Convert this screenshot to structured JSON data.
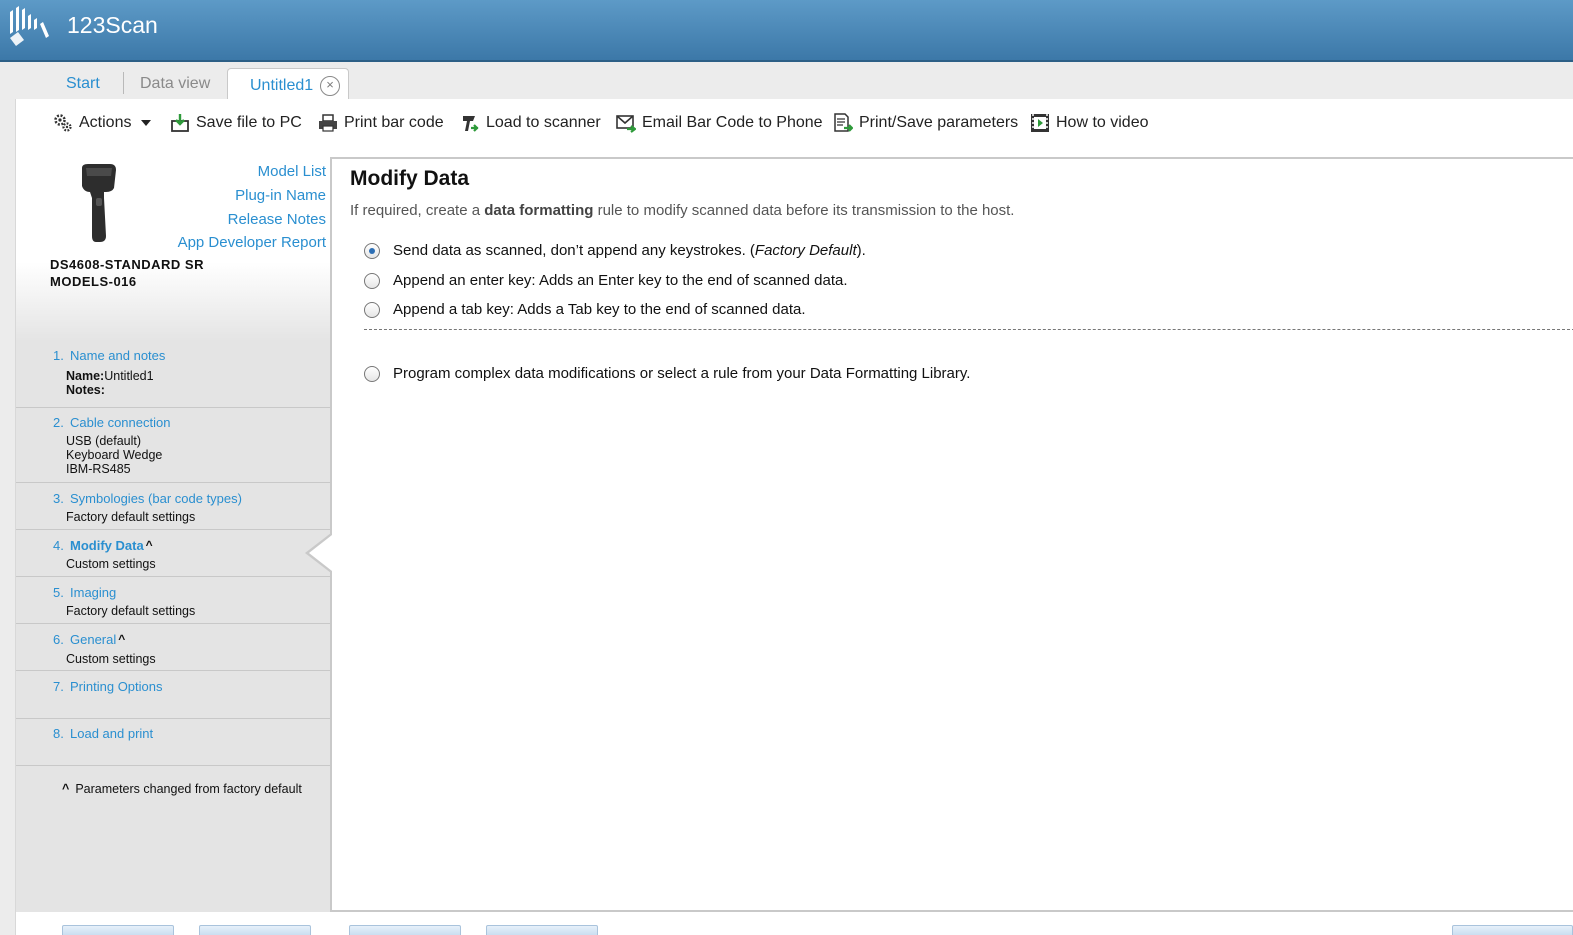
{
  "app": {
    "title": "123Scan"
  },
  "tabs": {
    "start": "Start",
    "data_view": "Data view",
    "active": "Untitled1",
    "close_glyph": "×"
  },
  "toolbar": {
    "actions": "Actions",
    "save": "Save file to PC",
    "print": "Print bar code",
    "load": "Load to scanner",
    "email": "Email Bar Code to Phone",
    "print_save_params": "Print/Save parameters",
    "video": "How to video"
  },
  "device": {
    "model_list": "Model List",
    "plugin_name": "Plug-in Name",
    "release_notes": "Release Notes",
    "dev_report": "App Developer Report",
    "name_line1": "DS4608-STANDARD SR",
    "name_line2": "MODELS-016"
  },
  "steps": [
    {
      "num": "1.",
      "title": "Name and notes",
      "lines": [
        "Untitled1",
        ""
      ],
      "name_label": "Name:",
      "notes_label": "Notes:"
    },
    {
      "num": "2.",
      "title": "Cable connection",
      "lines": [
        "USB (default)",
        "Keyboard Wedge",
        "IBM-RS485"
      ]
    },
    {
      "num": "3.",
      "title": "Symbologies (bar code types)",
      "lines": [
        "Factory default settings"
      ]
    },
    {
      "num": "4.",
      "title": "Modify Data",
      "mark": "^",
      "lines": [
        "Custom settings"
      ]
    },
    {
      "num": "5.",
      "title": "Imaging",
      "lines": [
        "Factory default settings"
      ]
    },
    {
      "num": "6.",
      "title": "General",
      "mark": "^",
      "lines": [
        "Custom settings"
      ]
    },
    {
      "num": "7.",
      "title": "Printing Options",
      "lines": []
    },
    {
      "num": "8.",
      "title": "Load and print",
      "lines": []
    }
  ],
  "footnote": {
    "mark": "^",
    "text": "Parameters changed from factory default"
  },
  "main": {
    "title": "Modify Data",
    "desc_pre": "If required, create a ",
    "desc_bold": "data formatting",
    "desc_post": " rule to modify scanned data before its transmission to the host.",
    "options": {
      "opt1_pre": "Send data as scanned, don’t append any keystrokes. (",
      "opt1_ital": "Factory Default",
      "opt1_post": ").",
      "opt2": "Append an enter key: Adds an Enter key to the end of scanned data.",
      "opt3": "Append a tab key: Adds a Tab key to the end of scanned data.",
      "opt4": "Program complex data modifications or select a rule from your Data Formatting Library."
    },
    "selected_option": 1
  },
  "colors": {
    "header": "#4a89b9",
    "link": "#2a8fd0",
    "radio_dot": "#2d6fb5"
  },
  "icons": [
    "zebra-logo-icon",
    "gear-icon",
    "save-icon",
    "printer-icon",
    "scanner-load-icon",
    "email-icon",
    "print-params-icon",
    "video-icon",
    "close-icon"
  ]
}
